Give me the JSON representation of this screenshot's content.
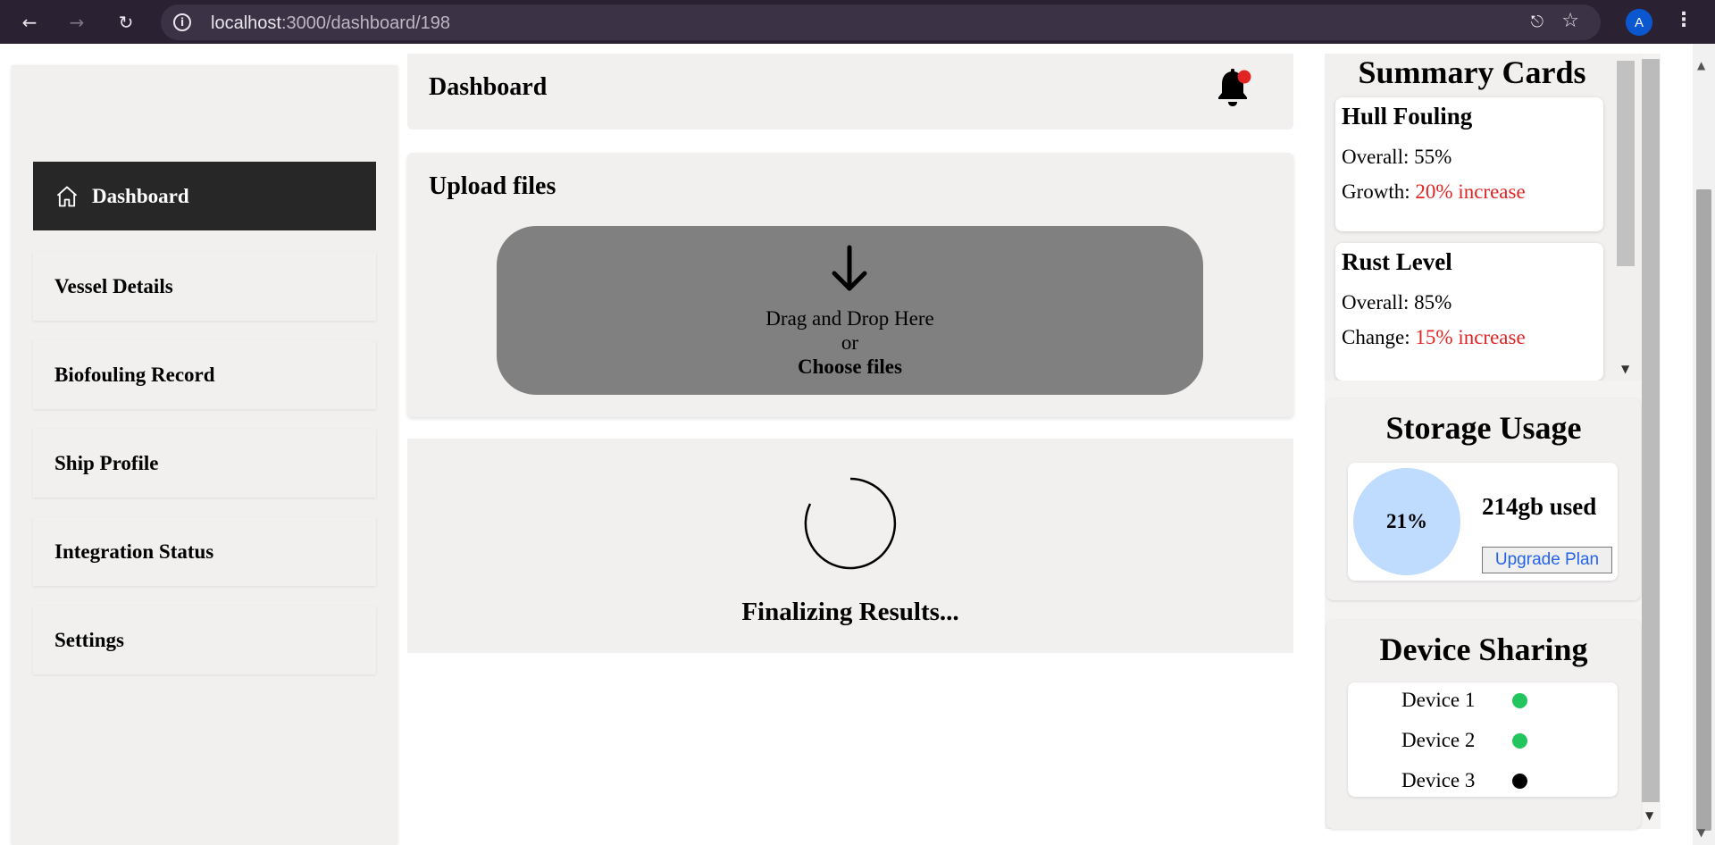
{
  "browser": {
    "url_host": "localhost",
    "url_path": ":3000/dashboard/198",
    "profile_initial": "A",
    "icons": [
      "back-icon",
      "forward-icon",
      "reload-icon",
      "site-info-icon",
      "install-app-icon",
      "bookmark-star-icon",
      "more-menu-icon"
    ]
  },
  "sidebar": {
    "items": [
      {
        "label": "Dashboard",
        "icon": "home-icon",
        "active": true
      },
      {
        "label": "Vessel Details"
      },
      {
        "label": "Biofouling Record"
      },
      {
        "label": "Ship Profile"
      },
      {
        "label": "Integration Status"
      },
      {
        "label": "Settings"
      }
    ]
  },
  "header": {
    "title": "Dashboard",
    "notification_icon": "bell-icon",
    "notification_dot_color": "#e02424"
  },
  "upload": {
    "title": "Upload files",
    "drop_text": "Drag and Drop Here",
    "or_text": "or",
    "choose_text": "Choose files"
  },
  "status": {
    "text": "Finalizing Results..."
  },
  "summary": {
    "title": "Summary Cards",
    "cards": [
      {
        "title": "Hull Fouling",
        "row1_label": "Overall:",
        "row1_value": "55%",
        "row2_label": "Growth:",
        "row2_value": "20% increase"
      },
      {
        "title": "Rust Level",
        "row1_label": "Overall:",
        "row1_value": "85%",
        "row2_label": "Change:",
        "row2_value": "15% increase"
      }
    ]
  },
  "storage": {
    "title": "Storage Usage",
    "percent_label": "21%",
    "used_label": "214gb used",
    "upgrade_label": "Upgrade Plan"
  },
  "devices": {
    "title": "Device Sharing",
    "items": [
      {
        "name": "Device 1",
        "color": "#22c55e"
      },
      {
        "name": "Device 2",
        "color": "#22c55e"
      },
      {
        "name": "Device 3",
        "color": "#000000"
      }
    ]
  }
}
